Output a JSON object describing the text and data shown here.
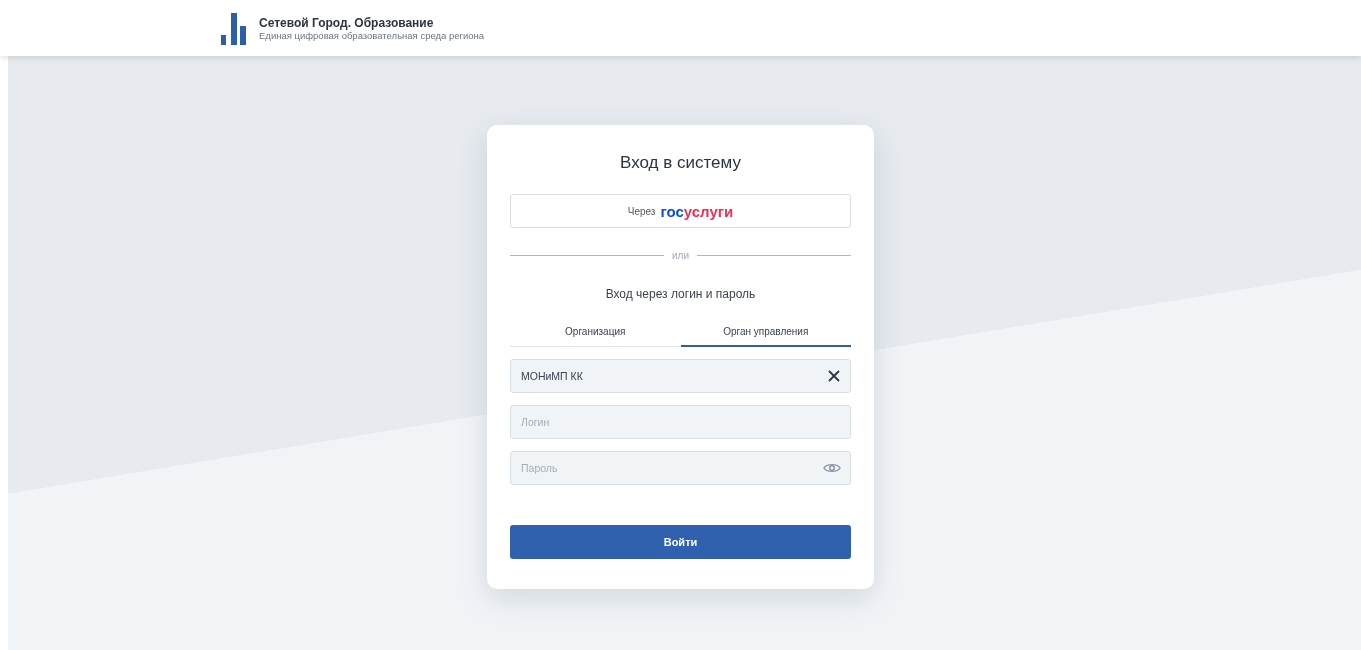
{
  "header": {
    "title": "Сетевой Город. Образование",
    "subtitle": "Единая цифровая образовательная среда региона"
  },
  "login": {
    "title": "Вход в систему",
    "gosuslugi_button": {
      "prefix": "Через",
      "logo_part_1": "гос",
      "logo_part_2": "услуги"
    },
    "divider": "или",
    "subtitle": "Вход через логин и пароль",
    "tabs": [
      {
        "label": "Организация",
        "selected": false
      },
      {
        "label": "Орган управления",
        "selected": true
      }
    ],
    "fields": [
      {
        "kind": "select",
        "value": "МОНиМП КК"
      },
      {
        "kind": "text",
        "placeholder": "Логин"
      },
      {
        "kind": "password",
        "placeholder": "Пароль"
      }
    ],
    "submit": "Войти"
  }
}
